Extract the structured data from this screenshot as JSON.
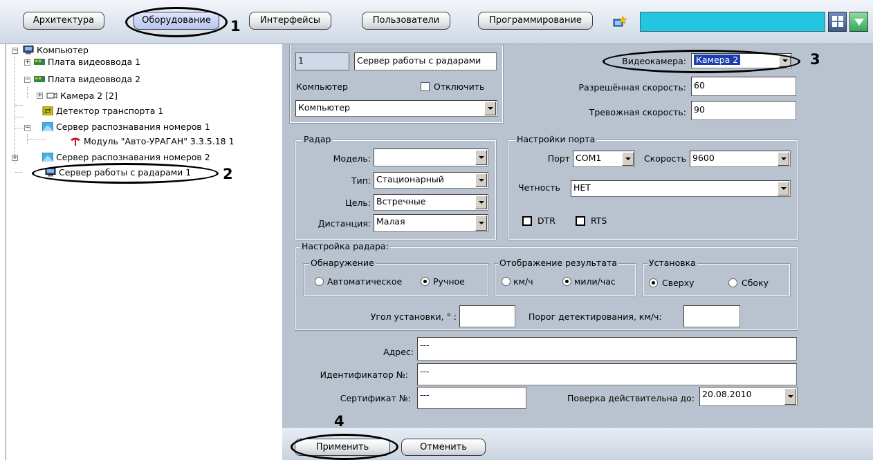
{
  "toolbar": {
    "tabs": [
      {
        "label": "Архитектура"
      },
      {
        "label": "Оборудование"
      },
      {
        "label": "Интерфейсы"
      },
      {
        "label": "Пользователи"
      },
      {
        "label": "Программирование"
      }
    ]
  },
  "callouts": {
    "n1": "1",
    "n2": "2",
    "n3": "3",
    "n4": "4"
  },
  "tree": {
    "items": [
      {
        "label": "Компьютер"
      },
      {
        "label": "Плата видеоввода 1"
      },
      {
        "label": "Плата видеоввода 2"
      },
      {
        "label": "Камера 2 [2]"
      },
      {
        "label": "Детектор транспорта 1"
      },
      {
        "label": "Сервер распознавания номеров 1"
      },
      {
        "label": "Модуль \"Авто-УРАГАН\" 3.3.5.18 1"
      },
      {
        "label": "Сервер распознавания номеров 2"
      },
      {
        "label": "Сервер работы с радарами 1"
      }
    ]
  },
  "header": {
    "id_value": "1",
    "name_value": "Сервер работы с радарами",
    "computer_label": "Компьютер",
    "disable_label": "Отключить",
    "computer_value": "Компьютер"
  },
  "camera": {
    "label": "Видеокамера:",
    "value": "Камера 2",
    "allowed_speed_label": "Разрешённая скорость:",
    "allowed_speed_value": "60",
    "alarm_speed_label": "Тревожная скорость:",
    "alarm_speed_value": "90"
  },
  "radar": {
    "legend": "Радар",
    "model_label": "Модель:",
    "model_value": "",
    "type_label": "Тип:",
    "type_value": "Стационарный",
    "target_label": "Цель:",
    "target_value": "Встречные",
    "distance_label": "Дистанция:",
    "distance_value": "Малая"
  },
  "port": {
    "legend": "Настройки порта",
    "port_label": "Порт",
    "port_value": "COM1",
    "speed_label": "Скорость",
    "speed_value": "9600",
    "parity_label": "Четность",
    "parity_value": "НЕТ",
    "dtr_label": "DTR",
    "rts_label": "RTS"
  },
  "radar_setup": {
    "legend": "Настройка радара:",
    "detection_legend": "Обнаружение",
    "detection_auto": "Автоматическое",
    "detection_manual": "Ручное",
    "display_legend": "Отображение результата",
    "display_kmh": "км/ч",
    "display_mph": "мили/час",
    "install_legend": "Установка",
    "install_top": "Сверху",
    "install_side": "Сбоку",
    "angle_label": "Угол установки, ° :",
    "angle_value": "",
    "threshold_label": "Порог детектирования, км/ч:",
    "threshold_value": ""
  },
  "info": {
    "address_label": "Адрес:",
    "address_value": "---",
    "identifier_label": "Идентификатор №:",
    "identifier_value": "---",
    "certificate_label": "Сертификат №:",
    "certificate_value": "---",
    "verify_label": "Поверка действительна до:",
    "verify_value": "20.08.2010"
  },
  "buttons": {
    "apply": "Применить",
    "cancel": "Отменить"
  }
}
